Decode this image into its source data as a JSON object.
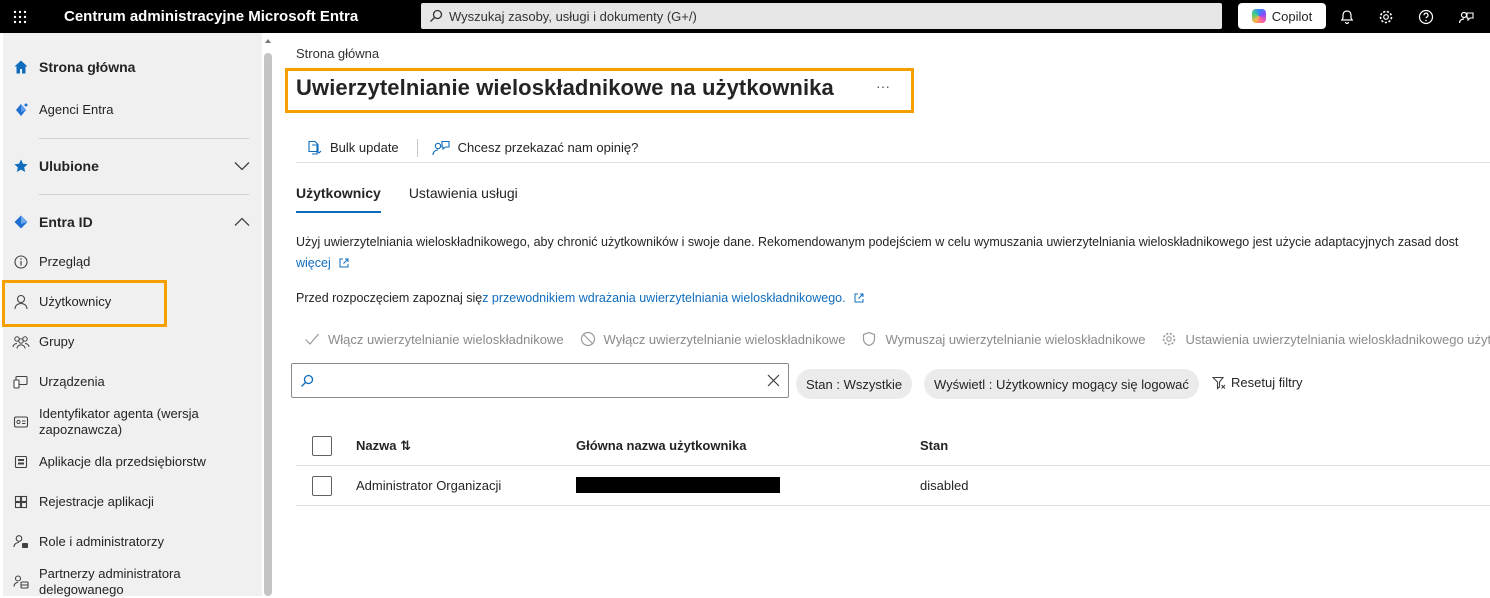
{
  "header": {
    "app_title": "Centrum administracyjne Microsoft Entra",
    "search_placeholder": "Wyszukaj zasoby, usługi i dokumenty (G+/)",
    "copilot_label": "Copilot",
    "icons": [
      "waffle-icon",
      "search-icon",
      "copilot-icon",
      "bell-icon",
      "gear-icon",
      "help-icon",
      "feedback-icon"
    ]
  },
  "sidebar": {
    "home": "Strona główna",
    "agents": "Agenci Entra",
    "favorites": "Ulubione",
    "entra_id": "Entra ID",
    "items": [
      {
        "label": "Przegląd",
        "icon": "info-icon"
      },
      {
        "label": "Użytkownicy",
        "icon": "user-icon"
      },
      {
        "label": "Grupy",
        "icon": "groups-icon"
      },
      {
        "label": "Urządzenia",
        "icon": "devices-icon"
      },
      {
        "label": "Identyfikator agenta (wersja zapoznawcza)",
        "icon": "agent-id-icon"
      },
      {
        "label": "Aplikacje dla przedsiębiorstw",
        "icon": "enterprise-apps-icon"
      },
      {
        "label": "Rejestracje aplikacji",
        "icon": "app-registrations-icon"
      },
      {
        "label": "Role i administratorzy",
        "icon": "roles-icon"
      },
      {
        "label": "Partnerzy administratora delegowanego",
        "icon": "partners-icon"
      }
    ],
    "highlight_color": "#f5a000"
  },
  "main": {
    "breadcrumb": "Strona główna",
    "title": "Uwierzytelnianie wieloskładnikowe na użytkownika",
    "more": "···",
    "commands": {
      "bulk_update": "Bulk update",
      "feedback": "Chcesz przekazać nam opinię?"
    },
    "tabs": [
      "Użytkownicy",
      "Ustawienia usługi"
    ],
    "description": {
      "text": "Użyj uwierzytelniania wieloskładnikowego, aby chronić użytkowników i swoje dane. Rekomendowanym podejściem w celu wymuszania uwierzytelniania wieloskładnikowego jest użycie adaptacyjnych zasad dost",
      "more_link": "więcej",
      "prefix": "Przed rozpoczęciem zapoznaj się ",
      "guide_link": "z przewodnikiem wdrażania uwierzytelniania wieloskładnikowego."
    },
    "actions": {
      "enable": "Włącz uwierzytelnianie wieloskładnikowe",
      "disable": "Wyłącz uwierzytelnianie wieloskładnikowe",
      "enforce": "Wymuszaj uwierzytelnianie wieloskładnikowe",
      "settings": "Ustawienia uwierzytelniania wieloskładnikowego użytk"
    },
    "filters": {
      "search_value": "",
      "state_pill": "Stan : Wszystkie",
      "show_pill": "Wyświetl : Użytkownicy mogący się logować",
      "reset": "Resetuj filtry"
    },
    "table": {
      "columns": [
        "Nazwa ⇅",
        "Główna nazwa użytkownika",
        "Stan"
      ],
      "rows": [
        {
          "name": "Administrator Organizacji",
          "upn": "",
          "state": "disabled"
        }
      ]
    }
  }
}
